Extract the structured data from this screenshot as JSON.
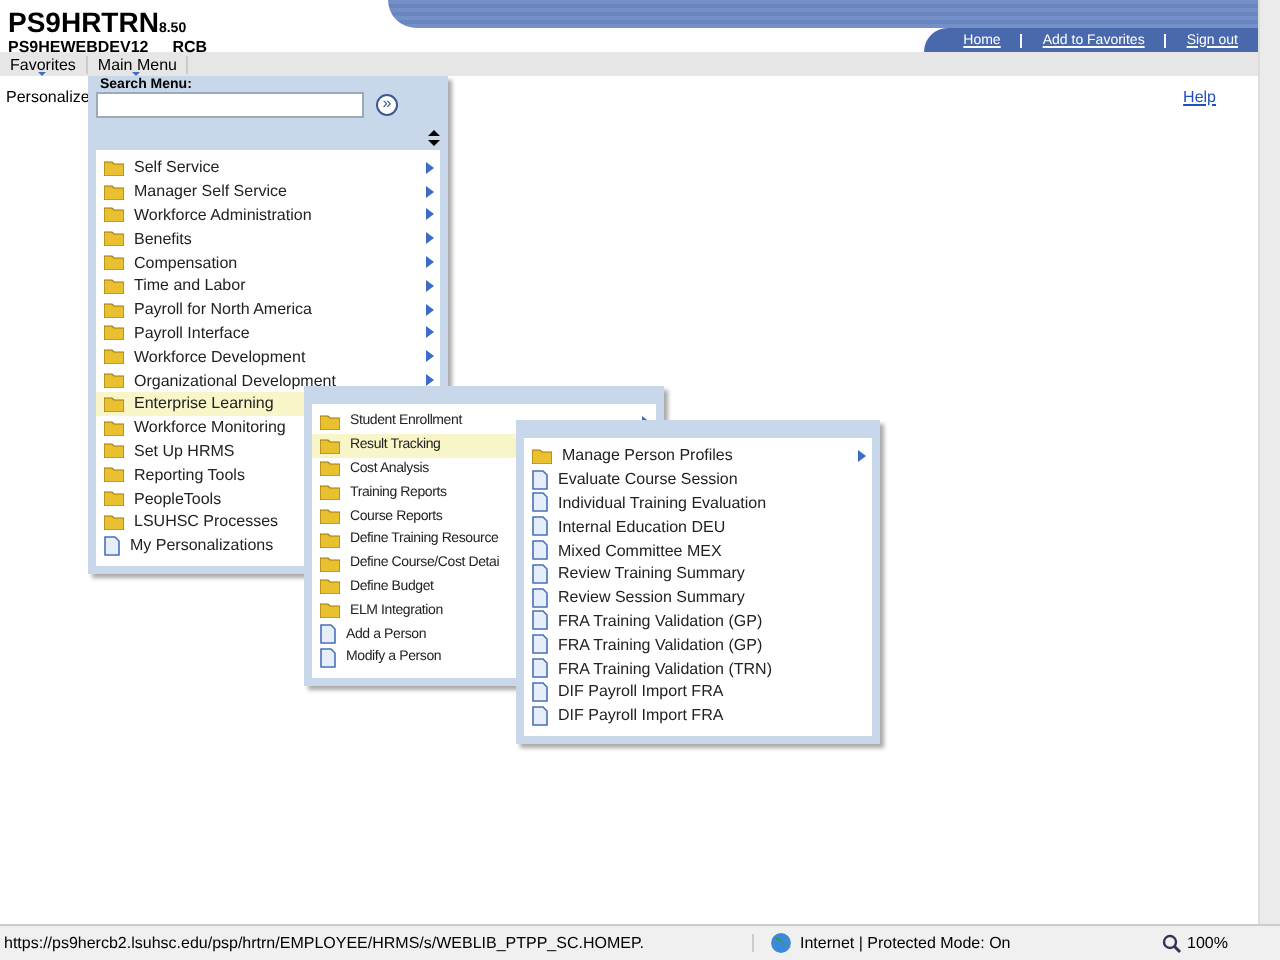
{
  "header": {
    "app_name": "PS9HRTRN",
    "version": "8.50",
    "server": "PS9HEWEBDEV12",
    "user": "RCB",
    "links": [
      "Home",
      "Add to Favorites",
      "Sign out"
    ]
  },
  "nav": [
    "Favorites",
    "Main Menu"
  ],
  "page": {
    "personalize": "Personalize",
    "help": "Help"
  },
  "main_menu": {
    "search_label": "Search Menu:",
    "search_go": "»",
    "items": [
      {
        "label": "Self Service",
        "kind": "folder",
        "has_submenu": true,
        "selected": false
      },
      {
        "label": "Manager Self Service",
        "kind": "folder",
        "has_submenu": true,
        "selected": false
      },
      {
        "label": "Workforce Administration",
        "kind": "folder",
        "has_submenu": true,
        "selected": false
      },
      {
        "label": "Benefits",
        "kind": "folder",
        "has_submenu": true,
        "selected": false
      },
      {
        "label": "Compensation",
        "kind": "folder",
        "has_submenu": true,
        "selected": false
      },
      {
        "label": "Time and Labor",
        "kind": "folder",
        "has_submenu": true,
        "selected": false
      },
      {
        "label": "Payroll for North America",
        "kind": "folder",
        "has_submenu": true,
        "selected": false
      },
      {
        "label": "Payroll Interface",
        "kind": "folder",
        "has_submenu": true,
        "selected": false
      },
      {
        "label": "Workforce Development",
        "kind": "folder",
        "has_submenu": true,
        "selected": false
      },
      {
        "label": "Organizational Development",
        "kind": "folder",
        "has_submenu": true,
        "selected": false
      },
      {
        "label": "Enterprise Learning",
        "kind": "folder",
        "selected": true
      },
      {
        "label": "Workforce Monitoring",
        "kind": "folder",
        "selected": false
      },
      {
        "label": "Set Up HRMS",
        "kind": "folder",
        "selected": false
      },
      {
        "label": "Reporting Tools",
        "kind": "folder",
        "selected": false
      },
      {
        "label": "PeopleTools",
        "kind": "folder",
        "selected": false
      },
      {
        "label": "LSUHSC Processes",
        "kind": "folder",
        "selected": false
      },
      {
        "label": "My Personalizations",
        "kind": "page",
        "selected": false
      }
    ]
  },
  "submenu_1": [
    {
      "label": "Student Enrollment",
      "kind": "folder",
      "has_submenu": true,
      "selected": false
    },
    {
      "label": "Result Tracking",
      "kind": "folder",
      "selected": true
    },
    {
      "label": "Cost Analysis",
      "kind": "folder",
      "selected": false
    },
    {
      "label": "Training Reports",
      "kind": "folder",
      "selected": false
    },
    {
      "label": "Course Reports",
      "kind": "folder",
      "selected": false
    },
    {
      "label": "Define Training Resource",
      "kind": "folder",
      "selected": false
    },
    {
      "label": "Define Course/Cost Detai",
      "kind": "folder",
      "selected": false
    },
    {
      "label": "Define Budget",
      "kind": "folder",
      "selected": false
    },
    {
      "label": "ELM Integration",
      "kind": "folder",
      "selected": false
    },
    {
      "label": "Add a Person",
      "kind": "page",
      "selected": false
    },
    {
      "label": "Modify a Person",
      "kind": "page",
      "selected": false
    }
  ],
  "submenu_2": [
    {
      "label": "Manage Person Profiles",
      "kind": "folder",
      "has_submenu": true,
      "selected": false
    },
    {
      "label": "Evaluate Course Session",
      "kind": "page",
      "has_submenu": false,
      "selected": false
    },
    {
      "label": "Individual Training Evaluation",
      "kind": "page",
      "has_submenu": false,
      "selected": false
    },
    {
      "label": "Internal Education DEU",
      "kind": "page",
      "has_submenu": false,
      "selected": false
    },
    {
      "label": "Mixed Committee MEX",
      "kind": "page",
      "has_submenu": false,
      "selected": false
    },
    {
      "label": "Review Training Summary",
      "kind": "page",
      "has_submenu": false,
      "selected": false
    },
    {
      "label": "Review Session Summary",
      "kind": "page",
      "has_submenu": false,
      "selected": false
    },
    {
      "label": "FRA Training Validation (GP)",
      "kind": "page",
      "has_submenu": false,
      "selected": false
    },
    {
      "label": "FRA Training Validation (GP)",
      "kind": "page",
      "has_submenu": false,
      "selected": false
    },
    {
      "label": "FRA Training Validation (TRN)",
      "kind": "page",
      "has_submenu": false,
      "selected": false
    },
    {
      "label": "DIF Payroll Import FRA",
      "kind": "page",
      "has_submenu": false,
      "selected": false
    },
    {
      "label": "DIF Payroll Import FRA",
      "kind": "page",
      "has_submenu": false,
      "selected": false
    }
  ],
  "status_bar": {
    "url": "https://ps9hercb2.lsuhsc.edu/psp/hrtrn/EMPLOYEE/HRMS/s/WEBLIB_PTPP_SC.HOMEP.",
    "zone": "Internet | Protected Mode: On",
    "zoom": "100%"
  }
}
